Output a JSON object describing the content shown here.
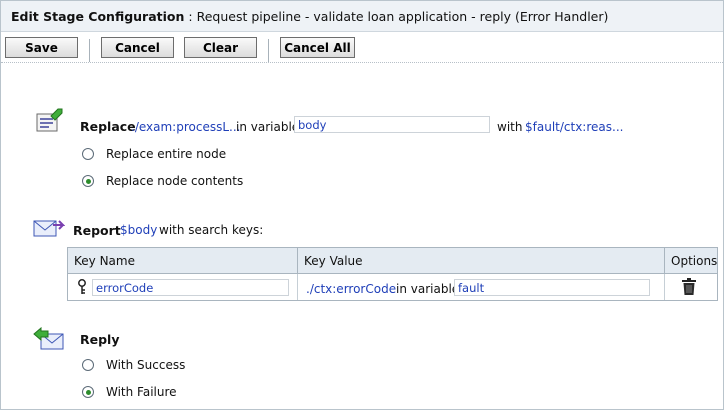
{
  "header": {
    "title_bold": "Edit Stage Configuration",
    "title_rest": ": Request pipeline - validate loan application - reply (Error Handler)"
  },
  "toolbar": {
    "save": "Save",
    "cancel": "Cancel",
    "clear": "Clear",
    "cancel_all": "Cancel All"
  },
  "replace": {
    "label": "Replace",
    "xpath": "./exam:processL...",
    "in_variable": "in variable",
    "variable": "body",
    "with": "with",
    "with_expr": "$fault/ctx:reas...",
    "options": [
      {
        "label": "Replace entire node",
        "selected": false
      },
      {
        "label": "Replace node contents",
        "selected": true
      }
    ]
  },
  "report": {
    "label": "Report",
    "expr": "$body",
    "suffix": "with search keys:",
    "columns": [
      "Key Name",
      "Key Value",
      "Options"
    ],
    "row": {
      "key_name": "errorCode",
      "key_value_xpath": "./ctx:errorCode",
      "in_variable": "in variable",
      "variable": "fault"
    }
  },
  "reply": {
    "label": "Reply",
    "options": [
      {
        "label": "With Success",
        "selected": false
      },
      {
        "label": "With Failure",
        "selected": true
      }
    ]
  },
  "icons": {
    "replace": "replace-action-icon",
    "report": "report-action-icon",
    "reply": "reply-action-icon",
    "key": "key-icon",
    "delete": "trash-icon"
  }
}
